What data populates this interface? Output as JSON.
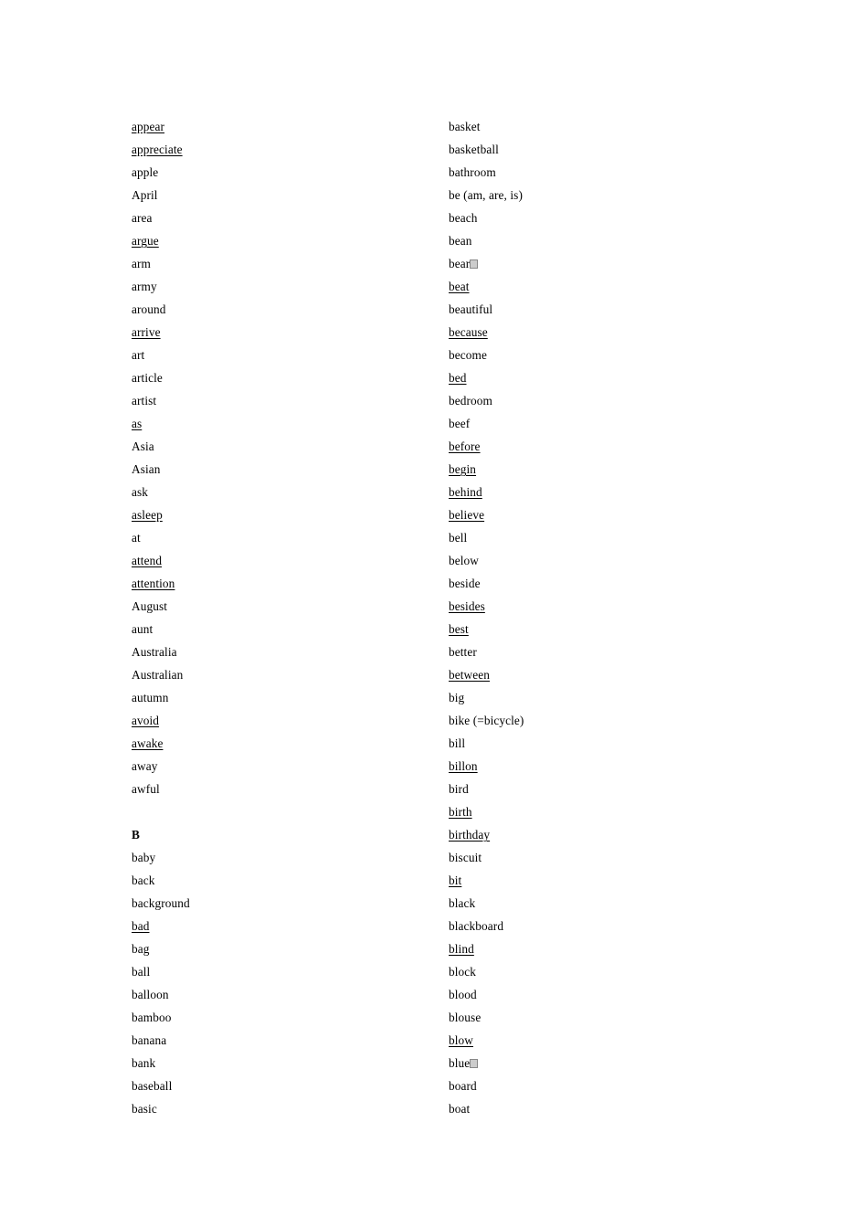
{
  "document": {
    "type": "vocabulary-word-list",
    "background_color": "#ffffff",
    "text_color": "#000000",
    "columns": 2
  },
  "left_column": [
    {
      "text": "appear",
      "underlined": true,
      "heading": false
    },
    {
      "text": "appreciate",
      "underlined": true,
      "heading": false
    },
    {
      "text": "apple",
      "underlined": false,
      "heading": false
    },
    {
      "text": "April",
      "underlined": false,
      "heading": false
    },
    {
      "text": "area",
      "underlined": false,
      "heading": false
    },
    {
      "text": "argue",
      "underlined": true,
      "heading": false
    },
    {
      "text": "arm",
      "underlined": false,
      "heading": false
    },
    {
      "text": "army",
      "underlined": false,
      "heading": false
    },
    {
      "text": "around",
      "underlined": false,
      "heading": false
    },
    {
      "text": "arrive",
      "underlined": true,
      "heading": false
    },
    {
      "text": "art",
      "underlined": false,
      "heading": false
    },
    {
      "text": "article",
      "underlined": false,
      "heading": false
    },
    {
      "text": "artist",
      "underlined": false,
      "heading": false
    },
    {
      "text": "as",
      "underlined": true,
      "heading": false
    },
    {
      "text": "Asia",
      "underlined": false,
      "heading": false
    },
    {
      "text": "Asian",
      "underlined": false,
      "heading": false
    },
    {
      "text": "ask",
      "underlined": false,
      "heading": false
    },
    {
      "text": "asleep",
      "underlined": true,
      "heading": false
    },
    {
      "text": "at",
      "underlined": false,
      "heading": false
    },
    {
      "text": "attend",
      "underlined": true,
      "heading": false
    },
    {
      "text": "attention",
      "underlined": true,
      "heading": false
    },
    {
      "text": "August",
      "underlined": false,
      "heading": false
    },
    {
      "text": "aunt",
      "underlined": false,
      "heading": false
    },
    {
      "text": "Australia",
      "underlined": false,
      "heading": false
    },
    {
      "text": "Australian",
      "underlined": false,
      "heading": false
    },
    {
      "text": "autumn",
      "underlined": false,
      "heading": false
    },
    {
      "text": "avoid",
      "underlined": true,
      "heading": false
    },
    {
      "text": "awake",
      "underlined": true,
      "heading": false
    },
    {
      "text": "away",
      "underlined": false,
      "heading": false
    },
    {
      "text": "awful",
      "underlined": false,
      "heading": false
    },
    {
      "text": "",
      "underlined": false,
      "heading": false,
      "spacer": true
    },
    {
      "text": "B",
      "underlined": false,
      "heading": true
    },
    {
      "text": "baby",
      "underlined": false,
      "heading": false
    },
    {
      "text": "back",
      "underlined": false,
      "heading": false
    },
    {
      "text": "background",
      "underlined": false,
      "heading": false
    },
    {
      "text": "bad",
      "underlined": true,
      "heading": false
    },
    {
      "text": "bag",
      "underlined": false,
      "heading": false
    },
    {
      "text": "ball",
      "underlined": false,
      "heading": false
    },
    {
      "text": "balloon",
      "underlined": false,
      "heading": false
    },
    {
      "text": "bamboo",
      "underlined": false,
      "heading": false
    },
    {
      "text": "banana",
      "underlined": false,
      "heading": false
    },
    {
      "text": "bank",
      "underlined": false,
      "heading": false
    },
    {
      "text": "baseball",
      "underlined": false,
      "heading": false
    },
    {
      "text": "basic",
      "underlined": false,
      "heading": false
    }
  ],
  "right_column": [
    {
      "text": "basket",
      "underlined": false,
      "heading": false
    },
    {
      "text": "basketball",
      "underlined": false,
      "heading": false
    },
    {
      "text": "bathroom",
      "underlined": false,
      "heading": false
    },
    {
      "text": "be (am, are, is)",
      "underlined": false,
      "heading": false
    },
    {
      "text": "beach",
      "underlined": false,
      "heading": false
    },
    {
      "text": "bean",
      "underlined": false,
      "heading": false
    },
    {
      "text": "bear",
      "underlined": false,
      "heading": false,
      "tofu": true
    },
    {
      "text": "beat",
      "underlined": true,
      "heading": false
    },
    {
      "text": "beautiful",
      "underlined": false,
      "heading": false
    },
    {
      "text": "because",
      "underlined": true,
      "heading": false
    },
    {
      "text": "become",
      "underlined": false,
      "heading": false
    },
    {
      "text": "bed",
      "underlined": true,
      "heading": false
    },
    {
      "text": "bedroom",
      "underlined": false,
      "heading": false
    },
    {
      "text": "beef",
      "underlined": false,
      "heading": false
    },
    {
      "text": "before",
      "underlined": true,
      "heading": false
    },
    {
      "text": "begin",
      "underlined": true,
      "heading": false
    },
    {
      "text": "behind",
      "underlined": true,
      "heading": false
    },
    {
      "text": "believe",
      "underlined": true,
      "heading": false
    },
    {
      "text": "bell",
      "underlined": false,
      "heading": false
    },
    {
      "text": "below",
      "underlined": false,
      "heading": false
    },
    {
      "text": "beside",
      "underlined": false,
      "heading": false
    },
    {
      "text": "besides",
      "underlined": true,
      "heading": false
    },
    {
      "text": "best",
      "underlined": true,
      "heading": false
    },
    {
      "text": "better",
      "underlined": false,
      "heading": false
    },
    {
      "text": "between",
      "underlined": true,
      "heading": false
    },
    {
      "text": "big",
      "underlined": false,
      "heading": false
    },
    {
      "text": "bike (=bicycle)",
      "underlined": false,
      "heading": false
    },
    {
      "text": "bill",
      "underlined": false,
      "heading": false
    },
    {
      "text": "billon",
      "underlined": true,
      "heading": false
    },
    {
      "text": "bird",
      "underlined": false,
      "heading": false
    },
    {
      "text": "birth",
      "underlined": true,
      "heading": false
    },
    {
      "text": "birthday",
      "underlined": true,
      "heading": false
    },
    {
      "text": "biscuit",
      "underlined": false,
      "heading": false
    },
    {
      "text": "bit",
      "underlined": true,
      "heading": false
    },
    {
      "text": "black",
      "underlined": false,
      "heading": false
    },
    {
      "text": "blackboard",
      "underlined": false,
      "heading": false
    },
    {
      "text": "blind",
      "underlined": true,
      "heading": false
    },
    {
      "text": "block",
      "underlined": false,
      "heading": false
    },
    {
      "text": "blood",
      "underlined": false,
      "heading": false
    },
    {
      "text": "blouse",
      "underlined": false,
      "heading": false
    },
    {
      "text": "blow",
      "underlined": true,
      "heading": false
    },
    {
      "text": "blue",
      "underlined": false,
      "heading": false,
      "tofu": true
    },
    {
      "text": "board",
      "underlined": false,
      "heading": false
    },
    {
      "text": "boat",
      "underlined": false,
      "heading": false
    }
  ]
}
